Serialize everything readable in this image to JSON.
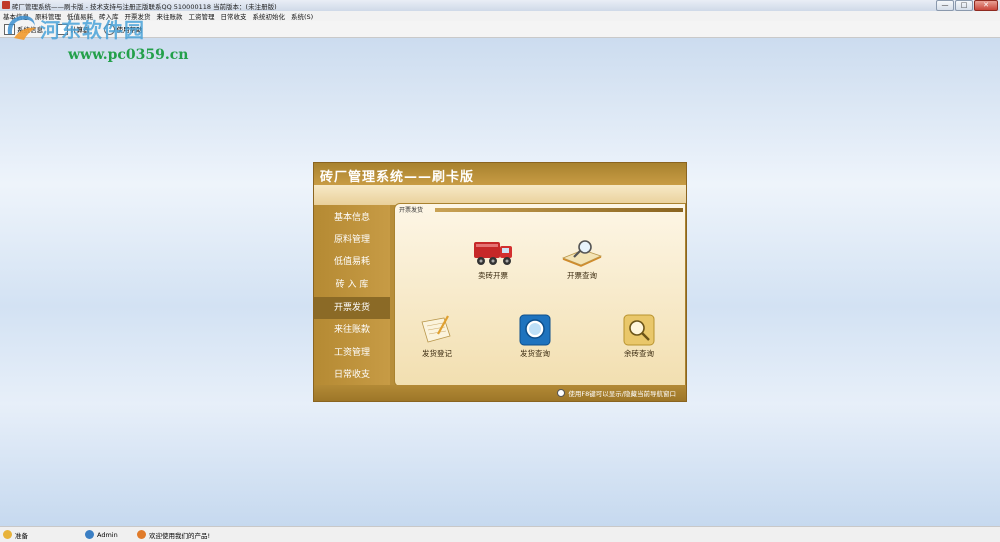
{
  "window": {
    "title": "砖厂管理系统——刷卡版 - 技术支持与注册正版联系QQ 510000118  当前版本：(未注册版)",
    "controls": [
      "—",
      "□",
      "✕"
    ]
  },
  "menu": [
    {
      "label": "基本信息"
    },
    {
      "label": "原料管理"
    },
    {
      "label": "低值易耗"
    },
    {
      "label": "砖入库"
    },
    {
      "label": "开票发货"
    },
    {
      "label": "来往账款"
    },
    {
      "label": "工资管理"
    },
    {
      "label": "日常收支"
    },
    {
      "label": "系统初始化"
    },
    {
      "label": "系统(S)"
    }
  ],
  "toolbar": [
    {
      "label": "系统信息",
      "icon": "window-icon"
    },
    {
      "label": "计算器",
      "icon": "calculator-icon"
    },
    {
      "label": "使用帮助",
      "icon": "help-icon"
    }
  ],
  "watermark": {
    "title": "河东软件园",
    "url": "www.pc0359.cn"
  },
  "panel": {
    "title": "砖厂管理系统——刷卡版",
    "nav": [
      {
        "label": "基本信息",
        "active": false
      },
      {
        "label": "原料管理",
        "active": false
      },
      {
        "label": "低值易耗",
        "active": false
      },
      {
        "label": "砖 入 库",
        "active": false
      },
      {
        "label": "开票发货",
        "active": true
      },
      {
        "label": "来往账款",
        "active": false
      },
      {
        "label": "工资管理",
        "active": false
      },
      {
        "label": "日常收支",
        "active": false
      }
    ],
    "content_tab": "开票发货",
    "tiles": [
      {
        "label": "卖砖开票",
        "icon": "fire-truck-icon"
      },
      {
        "label": "开票查询",
        "icon": "magnifier-book-icon"
      },
      {
        "label": "发货登记",
        "icon": "notebook-pen-icon"
      },
      {
        "label": "发货查询",
        "icon": "blue-search-icon"
      },
      {
        "label": "余砖查询",
        "icon": "gold-search-icon"
      }
    ],
    "footer_tip": "使用F8键可以显示/隐藏当前导航窗口"
  },
  "status": {
    "ready": "准备",
    "user": "Admin",
    "welcome": "欢迎使用我们的产品!"
  }
}
